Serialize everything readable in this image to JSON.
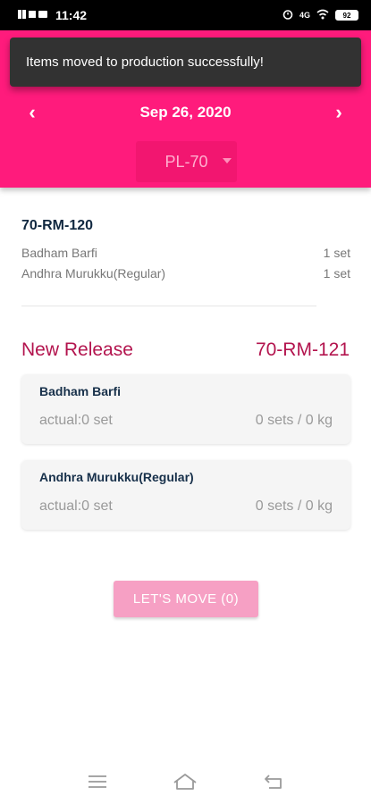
{
  "status_bar": {
    "time": "11:42",
    "battery": "92",
    "network": "4G"
  },
  "toast": {
    "message": "Items moved to production successfully!"
  },
  "header": {
    "date": "Sep 26, 2020",
    "prev_icon": "chevron-left-icon",
    "next_icon": "chevron-right-icon",
    "selector_value": "PL-70"
  },
  "batch": {
    "code": "70-RM-120",
    "items": [
      {
        "name": "Badham Barfi",
        "qty": "1 set"
      },
      {
        "name": "Andhra Murukku(Regular)",
        "qty": "1 set"
      }
    ]
  },
  "release": {
    "title": "New Release",
    "code": "70-RM-121",
    "items": [
      {
        "name": "Badham Barfi",
        "actual": "actual:0 set",
        "qty": "0 sets / 0 kg"
      },
      {
        "name": "Andhra Murukku(Regular)",
        "actual": "actual:0 set",
        "qty": "0 sets / 0 kg"
      }
    ]
  },
  "action": {
    "move_label": "LET'S MOVE (0)"
  },
  "colors": {
    "primary": "#ff1b7c",
    "accent_text": "#b3144e",
    "button_disabled": "#f6a0c4"
  }
}
